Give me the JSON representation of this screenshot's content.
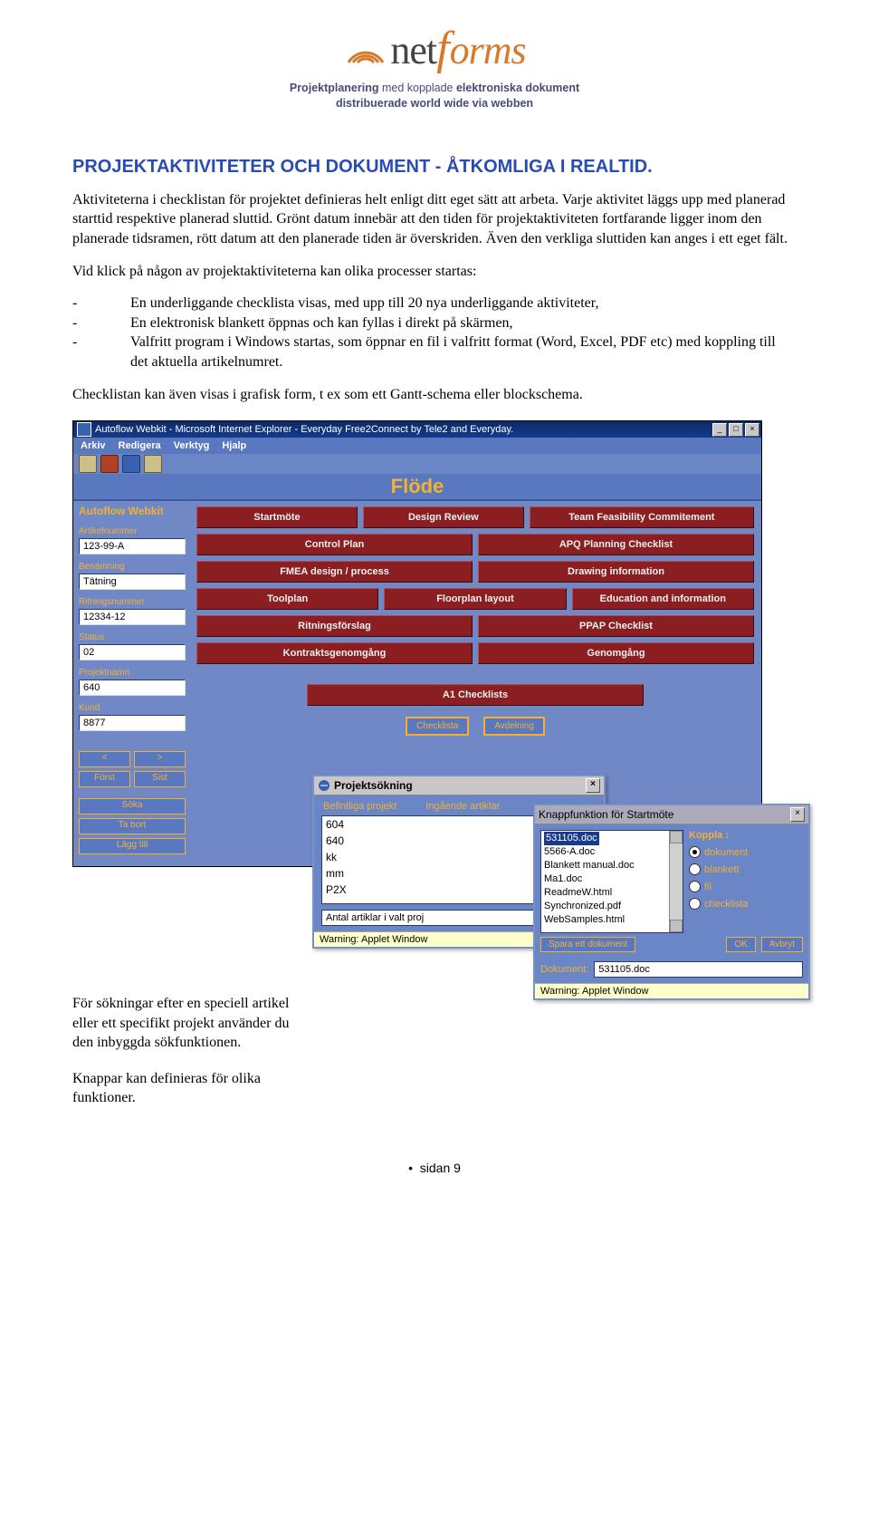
{
  "logo": {
    "part1": "net",
    "part2": "forms"
  },
  "tagline": {
    "l1_b1": "Projektplanering",
    "l1_n1": " med kopplade ",
    "l1_b2": "elektroniska dokument",
    "l2": "distribuerade world wide via webben"
  },
  "heading": "PROJEKTAKTIVITETER OCH DOKUMENT - ÅTKOMLIGA I REALTID.",
  "para1": "Aktiviteterna i checklistan för projektet definieras helt enligt ditt eget sätt att arbeta. Varje aktivitet läggs upp med planerad starttid respektive planerad sluttid. Grönt datum innebär att den tiden för projektaktiviteten fortfarande ligger inom den planerade tidsramen, rött datum att den planerade tiden är överskriden. Även den verkliga sluttiden kan anges i ett eget fält.",
  "para2": "Vid klick på någon av projektaktiviteterna kan olika processer startas:",
  "bullets": [
    "En underliggande checklista visas, med upp till 20 nya underliggande aktiviteter,",
    "En elektronisk blankett öppnas och kan fyllas i direkt på skärmen,",
    "Valfritt program i Windows startas, som öppnar en fil i valfritt format (Word, Excel, PDF etc) med koppling till det aktuella artikelnumret."
  ],
  "para3": "Checklistan kan även visas i grafisk form, t ex som ett Gantt-schema eller blockschema.",
  "app": {
    "title": "Autoflow Webkit - Microsoft Internet Explorer - Everyday Free2Connect by Tele2 and Everyday.",
    "menu": [
      "Arkiv",
      "Redigera",
      "Verktyg",
      "Hjalp"
    ],
    "flode": "Flöde",
    "kit": "Autoflow Webkit",
    "fields": [
      {
        "label": "Artikelnummer",
        "value": "123-99-A"
      },
      {
        "label": "Benämning",
        "value": "Tätning"
      },
      {
        "label": "Ritningsnummer",
        "value": "12334-12"
      },
      {
        "label": "Status",
        "value": "02"
      },
      {
        "label": "Projektnamn",
        "value": "640"
      },
      {
        "label": "Kund",
        "value": "8877"
      }
    ],
    "flow": {
      "r1": [
        "Startmöte",
        "Design Review",
        "Team Feasibility Commitement"
      ],
      "r2": [
        "Control Plan",
        "APQ Planning Checklist"
      ],
      "r3": [
        "FMEA design / process",
        "Drawing information"
      ],
      "r4": [
        "Toolplan",
        "Floorplan layout",
        "Education and information"
      ],
      "r5": [
        "Ritningsförslag",
        "PPAP Checklist"
      ],
      "r6": [
        "Kontraktsgenomgång",
        "Genomgång"
      ],
      "r7": [
        "A1 Checklists"
      ]
    },
    "nav": {
      "prev": "<",
      "next": ">",
      "first": "Först",
      "last": "Sist"
    },
    "actions": [
      "Söka",
      "Ta bort",
      "Lägg till"
    ],
    "bottom": [
      "Checklista",
      "Avdelning"
    ]
  },
  "dlg_search": {
    "title": "Projektsökning",
    "tab1": "Befintliga projekt",
    "tab2": "Ingående artiklar",
    "items": [
      "604",
      "640",
      "kk",
      "mm",
      "P2X"
    ],
    "summary": "Antal artiklar i valt proj",
    "warning": "Warning: Applet Window"
  },
  "dlg_knapp": {
    "title": "Knappfunktion för Startmöte",
    "files": [
      "531105.doc",
      "5566-A.doc",
      "Blankett manual.doc",
      "Ma1.doc",
      "ReadmeW.html",
      "Synchronized.pdf",
      "WebSamples.html"
    ],
    "selected_index": 0,
    "koppla_label": "Koppla :",
    "radios": [
      "dokument",
      "blankett",
      "fil",
      "checklista"
    ],
    "radio_selected": 0,
    "spara": "Spara ett dokument",
    "ok": "OK",
    "avbryt": "Avbryt",
    "doc_label": "Dokument:",
    "doc_value": "531105.doc",
    "warning": "Warning: Applet Window"
  },
  "lower": {
    "p1": "För sökningar efter en speciell artikel eller ett specifikt projekt använder du den inbyggda sökfunktionen.",
    "p2": "Knappar kan definieras för olika funktioner."
  },
  "footer": "sidan 9"
}
